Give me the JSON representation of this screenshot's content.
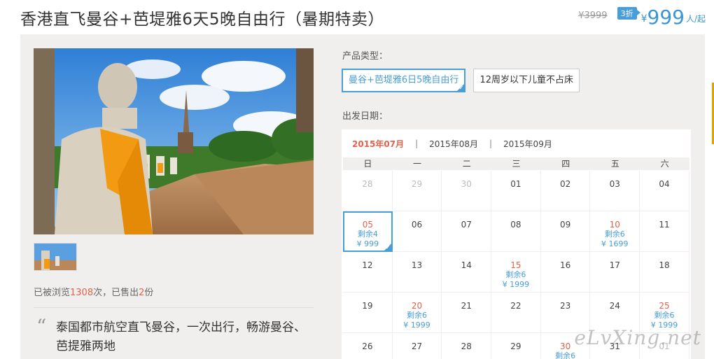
{
  "header": {
    "title": "香港直飞曼谷+芭堤雅6天5晚自由行（暑期特卖）",
    "old_price": "¥3999",
    "discount": "3折",
    "currency": "¥",
    "price": "999",
    "unit": "人/起"
  },
  "stats": {
    "prefix": "已被浏览",
    "views": "1308",
    "mid": "次，已售出",
    "sold": "2",
    "suffix": "份"
  },
  "intro": {
    "quote_mark": "“",
    "text": "泰国都市航空直飞曼谷，一次出行，畅游曼谷、芭提雅两地"
  },
  "product": {
    "label": "产品类型：",
    "options": [
      "曼谷+芭堤雅6日5晚自由行",
      "12周岁以下儿童不占床"
    ],
    "selected_index": 0
  },
  "calendar": {
    "label": "出发日期：",
    "months": [
      "2015年07月",
      "2015年08月",
      "2015年09月"
    ],
    "active_month": 0,
    "separator": "|",
    "weekdays": [
      "日",
      "一",
      "二",
      "三",
      "四",
      "五",
      "六"
    ],
    "days": [
      {
        "d": "28",
        "other": true
      },
      {
        "d": "29",
        "other": true
      },
      {
        "d": "30",
        "other": true
      },
      {
        "d": "01"
      },
      {
        "d": "02"
      },
      {
        "d": "03"
      },
      {
        "d": "04"
      },
      {
        "d": "05",
        "s": "剩余4",
        "p": "¥ 999",
        "selected": true
      },
      {
        "d": "06"
      },
      {
        "d": "07"
      },
      {
        "d": "08"
      },
      {
        "d": "09"
      },
      {
        "d": "10",
        "s": "剩余6",
        "p": "¥ 1699"
      },
      {
        "d": "11"
      },
      {
        "d": "12"
      },
      {
        "d": "13"
      },
      {
        "d": "14"
      },
      {
        "d": "15",
        "s": "剩余6",
        "p": "¥ 1999"
      },
      {
        "d": "16"
      },
      {
        "d": "17"
      },
      {
        "d": "18"
      },
      {
        "d": "19"
      },
      {
        "d": "20",
        "s": "剩余6",
        "p": "¥ 1999"
      },
      {
        "d": "21"
      },
      {
        "d": "22"
      },
      {
        "d": "23"
      },
      {
        "d": "24"
      },
      {
        "d": "25",
        "s": "剩余6",
        "p": "¥ 1999"
      },
      {
        "d": "26"
      },
      {
        "d": "27"
      },
      {
        "d": "28"
      },
      {
        "d": "29"
      },
      {
        "d": "30",
        "s": "剩余6",
        "p": ""
      },
      {
        "d": "31"
      },
      {
        "d": "01",
        "other": true
      }
    ]
  },
  "watermark": "eLvXing.net",
  "colors": {
    "accent": "#4a9ed8",
    "highlight": "#e4614b",
    "panel": "#f0efed"
  }
}
